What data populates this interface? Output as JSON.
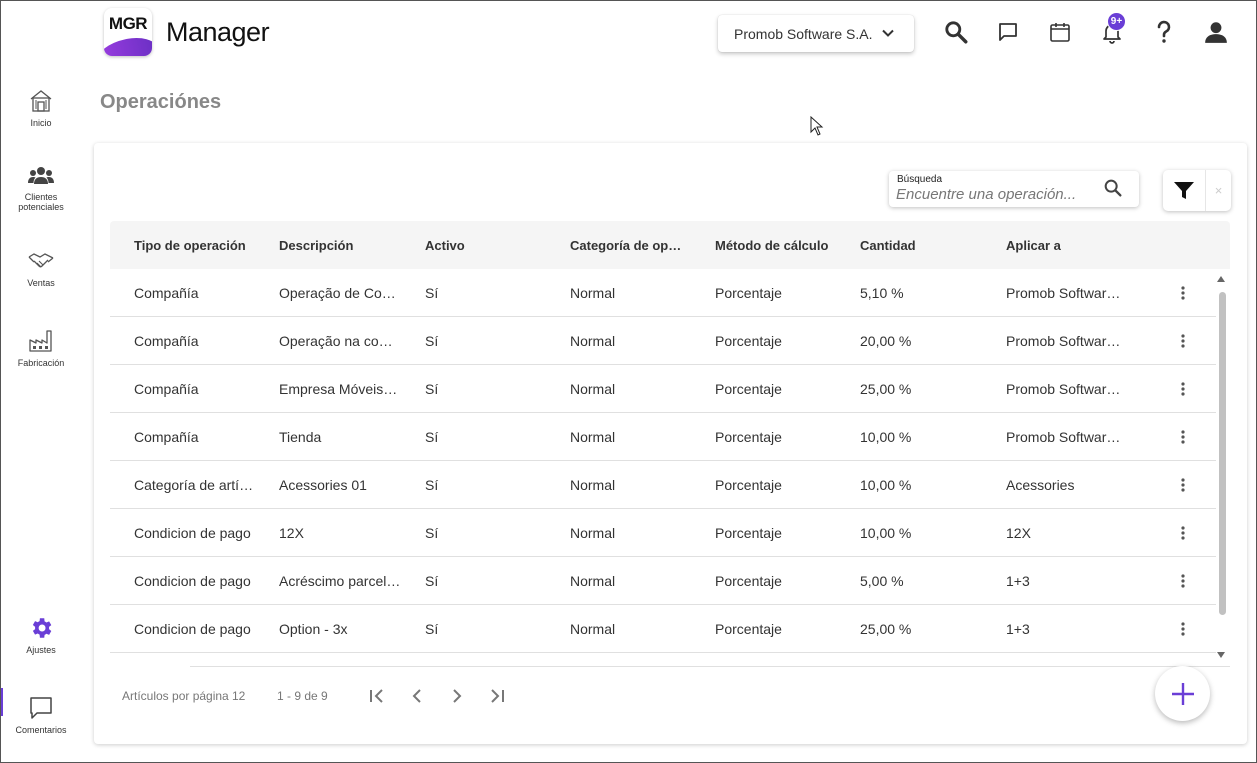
{
  "brand": {
    "logo_text": "MGR",
    "app_title": "Manager",
    "accent": "#6a3ed6"
  },
  "header": {
    "company_select": "Promob Software S.A.",
    "notification_badge": "9+",
    "icons": [
      "search-icon",
      "chat-icon",
      "calendar-icon",
      "bell-icon",
      "help-icon",
      "account-icon"
    ]
  },
  "sidebar": {
    "items": [
      {
        "label": "Inicio",
        "icon": "home-icon"
      },
      {
        "label": "Clientes potenciales",
        "icon": "people-icon"
      },
      {
        "label": "Ventas",
        "icon": "handshake-icon"
      },
      {
        "label": "Fabricación",
        "icon": "factory-icon"
      },
      {
        "label": "Ajustes",
        "icon": "gear-icon",
        "active": true
      },
      {
        "label": "Comentarios",
        "icon": "comment-icon"
      }
    ]
  },
  "page": {
    "title": "Operaciónes"
  },
  "search": {
    "label": "Búsqueda",
    "placeholder": "Encuentre una operación...",
    "value": ""
  },
  "filter": {
    "clear": "×"
  },
  "table": {
    "columns": [
      "Tipo de operación",
      "Descripción",
      "Activo",
      "Categoría de operación",
      "Método de cálculo",
      "Cantidad",
      "Aplicar a"
    ],
    "rows": [
      [
        "Compañía",
        "Operação de Compañía",
        "Sí",
        "Normal",
        "Porcentaje",
        "5,10 %",
        "Promob Software S.A."
      ],
      [
        "Compañía",
        "Operação na compañía",
        "Sí",
        "Normal",
        "Porcentaje",
        "20,00 %",
        "Promob Software S.A."
      ],
      [
        "Compañía",
        "Empresa Móveis Ltda",
        "Sí",
        "Normal",
        "Porcentaje",
        "25,00 %",
        "Promob Software S.A."
      ],
      [
        "Compañía",
        "Tienda",
        "Sí",
        "Normal",
        "Porcentaje",
        "10,00 %",
        "Promob Software S.A."
      ],
      [
        "Categoría de artículo",
        "Acessories 01",
        "Sí",
        "Normal",
        "Porcentaje",
        "10,00 %",
        "Acessories"
      ],
      [
        "Condicion de pago",
        "12X",
        "Sí",
        "Normal",
        "Porcentaje",
        "10,00 %",
        "12X"
      ],
      [
        "Condicion de pago",
        "Acréscimo parcelado",
        "Sí",
        "Normal",
        "Porcentaje",
        "5,00 %",
        "1+3"
      ],
      [
        "Condicion de pago",
        "Option - 3x",
        "Sí",
        "Normal",
        "Porcentaje",
        "25,00 %",
        "1+3"
      ]
    ]
  },
  "paginator": {
    "items_per_page_label": "Artículos por página",
    "items_per_page": "12",
    "range": "1 - 9 de 9"
  }
}
